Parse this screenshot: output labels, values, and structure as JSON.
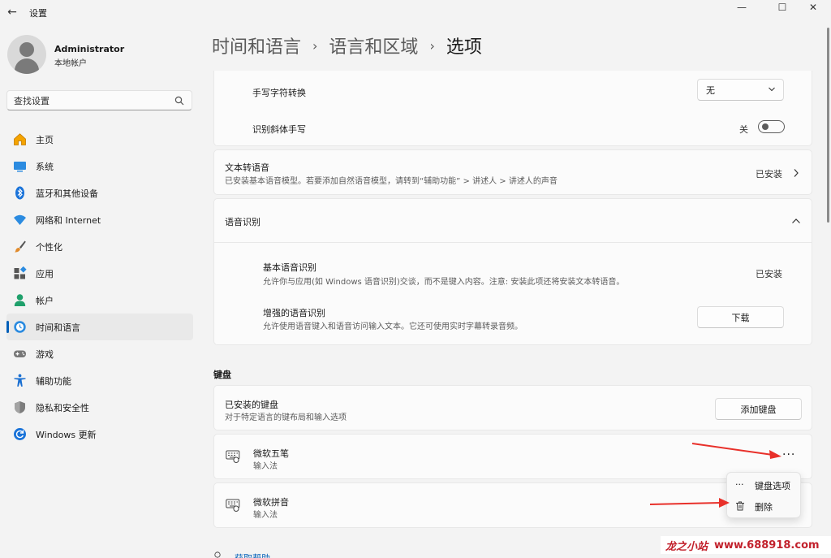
{
  "window": {
    "title": "设置",
    "back_glyph": "←",
    "minimize_glyph": "—",
    "maximize_glyph": "☐",
    "close_glyph": "✕"
  },
  "profile": {
    "name": "Administrator",
    "account_type": "本地帐户"
  },
  "search": {
    "value": "查找设置"
  },
  "sidebar": {
    "items": [
      {
        "label": "主页",
        "icon": "home-icon",
        "active": false
      },
      {
        "label": "系统",
        "icon": "system-icon",
        "active": false
      },
      {
        "label": "蓝牙和其他设备",
        "icon": "bluetooth-icon",
        "active": false
      },
      {
        "label": "网络和 Internet",
        "icon": "wifi-icon",
        "active": false
      },
      {
        "label": "个性化",
        "icon": "brush-icon",
        "active": false
      },
      {
        "label": "应用",
        "icon": "apps-icon",
        "active": false
      },
      {
        "label": "帐户",
        "icon": "account-icon",
        "active": false
      },
      {
        "label": "时间和语言",
        "icon": "time-language-icon",
        "active": true
      },
      {
        "label": "游戏",
        "icon": "gamepad-icon",
        "active": false
      },
      {
        "label": "辅助功能",
        "icon": "accessibility-icon",
        "active": false
      },
      {
        "label": "隐私和安全性",
        "icon": "shield-icon",
        "active": false
      },
      {
        "label": "Windows 更新",
        "icon": "update-icon",
        "active": false
      }
    ]
  },
  "breadcrumb": {
    "part1": "时间和语言",
    "part2": "语言和区域",
    "current": "选项",
    "separator": "›"
  },
  "handwriting": {
    "conversion_label": "手写字符转换",
    "conversion_value": "无",
    "italic_label": "识别斜体手写",
    "italic_state": "关"
  },
  "tts": {
    "title": "文本转语音",
    "desc": "已安装基本语音模型。若要添加自然语音模型，请转到“辅助功能” > 讲述人 > 讲述人的声音",
    "status": "已安装"
  },
  "speech": {
    "title": "语音识别",
    "basic_title": "基本语音识别",
    "basic_desc": "允许你与应用(如 Windows 语音识别)交谈，而不是键入内容。注意: 安装此项还将安装文本转语音。",
    "basic_status": "已安装",
    "enhanced_title": "增强的语音识别",
    "enhanced_desc": "允许使用语音键入和语音访问输入文本。它还可使用实时字幕转录音频。",
    "download_label": "下载"
  },
  "keyboard": {
    "section_title": "键盘",
    "installed_title": "已安装的键盘",
    "installed_desc": "对于特定语言的键布局和输入选项",
    "add_label": "添加键盘",
    "items": [
      {
        "name": "微软五笔",
        "type": "输入法"
      },
      {
        "name": "微软拼音",
        "type": "输入法"
      }
    ],
    "more_glyph": "···"
  },
  "context_menu": {
    "options_glyph": "···",
    "options_label": "键盘选项",
    "delete_label": "删除"
  },
  "footer": {
    "help_label": "获取帮助"
  },
  "watermark": {
    "brand": "龙之小站",
    "url": "www.688918.com"
  },
  "colors": {
    "accent": "#005fb8",
    "arrow": "#e8302a",
    "watermark": "#c2212c"
  }
}
